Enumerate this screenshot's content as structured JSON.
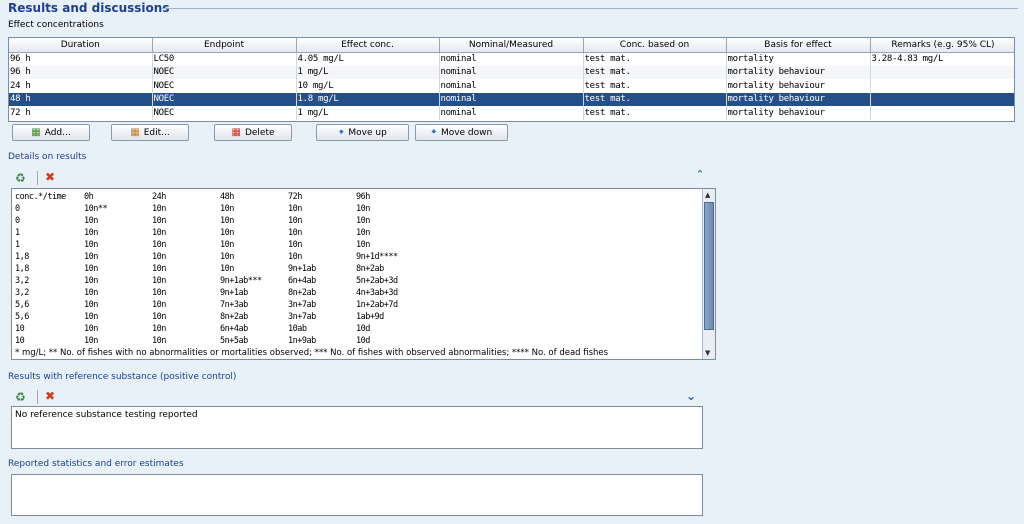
{
  "section": {
    "title": "Results and discussions"
  },
  "effect_concentrations": {
    "label": "Effect concentrations",
    "columns": [
      "Duration",
      "Endpoint",
      "Effect conc.",
      "Nominal/Measured",
      "Conc. based on",
      "Basis for effect",
      "Remarks (e.g. 95% CL)"
    ],
    "rows": [
      [
        "96 h",
        "LC50",
        "4.05 mg/L",
        "nominal",
        "test mat.",
        "mortality",
        "3.28-4.83 mg/L"
      ],
      [
        "96 h",
        "NOEC",
        "1 mg/L",
        "nominal",
        "test mat.",
        "mortality behaviour",
        ""
      ],
      [
        "24 h",
        "NOEC",
        "10 mg/L",
        "nominal",
        "test mat.",
        "mortality behaviour",
        ""
      ],
      [
        "48 h",
        "NOEC",
        "1.8 mg/L",
        "nominal",
        "test mat.",
        "mortality behaviour",
        ""
      ],
      [
        "72 h",
        "NOEC",
        "1 mg/L",
        "nominal",
        "test mat.",
        "mortality behaviour",
        ""
      ]
    ],
    "selected_row": 3
  },
  "buttons": {
    "add": "Add...",
    "edit": "Edit...",
    "delete": "Delete",
    "move_up": "Move up",
    "move_down": "Move down"
  },
  "details": {
    "label": "Details on results",
    "rows": [
      [
        "conc.*/time",
        "0h",
        "24h",
        "48h",
        "72h",
        "96h"
      ],
      [
        "0",
        "10n**",
        "10n",
        "10n",
        "10n",
        "10n"
      ],
      [
        "0",
        "10n",
        "10n",
        "10n",
        "10n",
        "10n"
      ],
      [
        "1",
        "10n",
        "10n",
        "10n",
        "10n",
        "10n"
      ],
      [
        "1",
        "10n",
        "10n",
        "10n",
        "10n",
        "10n"
      ],
      [
        "1,8",
        "10n",
        "10n",
        "10n",
        "10n",
        "9n+1d****"
      ],
      [
        "1,8",
        "10n",
        "10n",
        "10n",
        "9n+1ab",
        "8n+2ab"
      ],
      [
        "3,2",
        "10n",
        "10n",
        "9n+1ab***",
        "6n+4ab",
        "5n+2ab+3d"
      ],
      [
        "3,2",
        "10n",
        "10n",
        "9n+1ab",
        "8n+2ab",
        "4n+3ab+3d"
      ],
      [
        "5,6",
        "10n",
        "10n",
        "7n+3ab",
        "3n+7ab",
        "1n+2ab+7d"
      ],
      [
        "5,6",
        "10n",
        "10n",
        "8n+2ab",
        "3n+7ab",
        "1ab+9d"
      ],
      [
        "10",
        "10n",
        "10n",
        "6n+4ab",
        "10ab",
        "10d"
      ],
      [
        "10",
        "10n",
        "10n",
        "5n+5ab",
        "1n+9ab",
        "10d"
      ]
    ],
    "footnote": "* mg/L; ** No. of fishes with no abnormalities or mortalities observed; *** No. of fishes with observed abnormalities; **** No. of dead fishes"
  },
  "reference": {
    "label": "Results with reference substance (positive control)",
    "text": "No reference substance testing reported"
  },
  "statistics": {
    "label": "Reported statistics and error estimates",
    "text": ""
  },
  "icons": {
    "add_record": "green-add-icon",
    "delete_record": "red-x-icon",
    "collapse": "double-chevron-up-icon",
    "expand": "double-chevron-down-icon"
  },
  "colors": {
    "title": "#1f3f8f",
    "selected_row": "#244f88",
    "background": "#e8f0f8"
  }
}
